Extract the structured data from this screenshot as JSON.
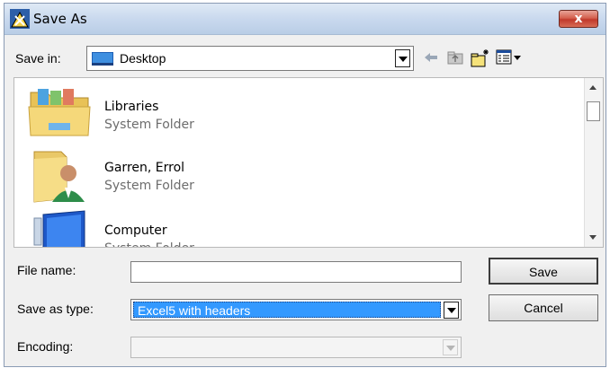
{
  "window": {
    "title": "Save As",
    "close_label": "x"
  },
  "save_in": {
    "label": "Save in:",
    "value": "Desktop"
  },
  "files": [
    {
      "name": "Libraries",
      "type": "System Folder",
      "icon": "libraries-folder-icon"
    },
    {
      "name": "Garren, Errol",
      "type": "System Folder",
      "icon": "user-folder-icon"
    },
    {
      "name": "Computer",
      "type": "System Folder",
      "icon": "computer-icon"
    }
  ],
  "fields": {
    "file_name_label": "File name:",
    "file_name_value": "",
    "save_as_type_label": "Save as type:",
    "save_as_type_value": "Excel5 with headers",
    "encoding_label": "Encoding:",
    "encoding_value": ""
  },
  "buttons": {
    "save": "Save",
    "cancel": "Cancel"
  },
  "colors": {
    "selection": "#3399ff",
    "title_gradient": "#c9d9ee",
    "close_red": "#c0392b"
  }
}
